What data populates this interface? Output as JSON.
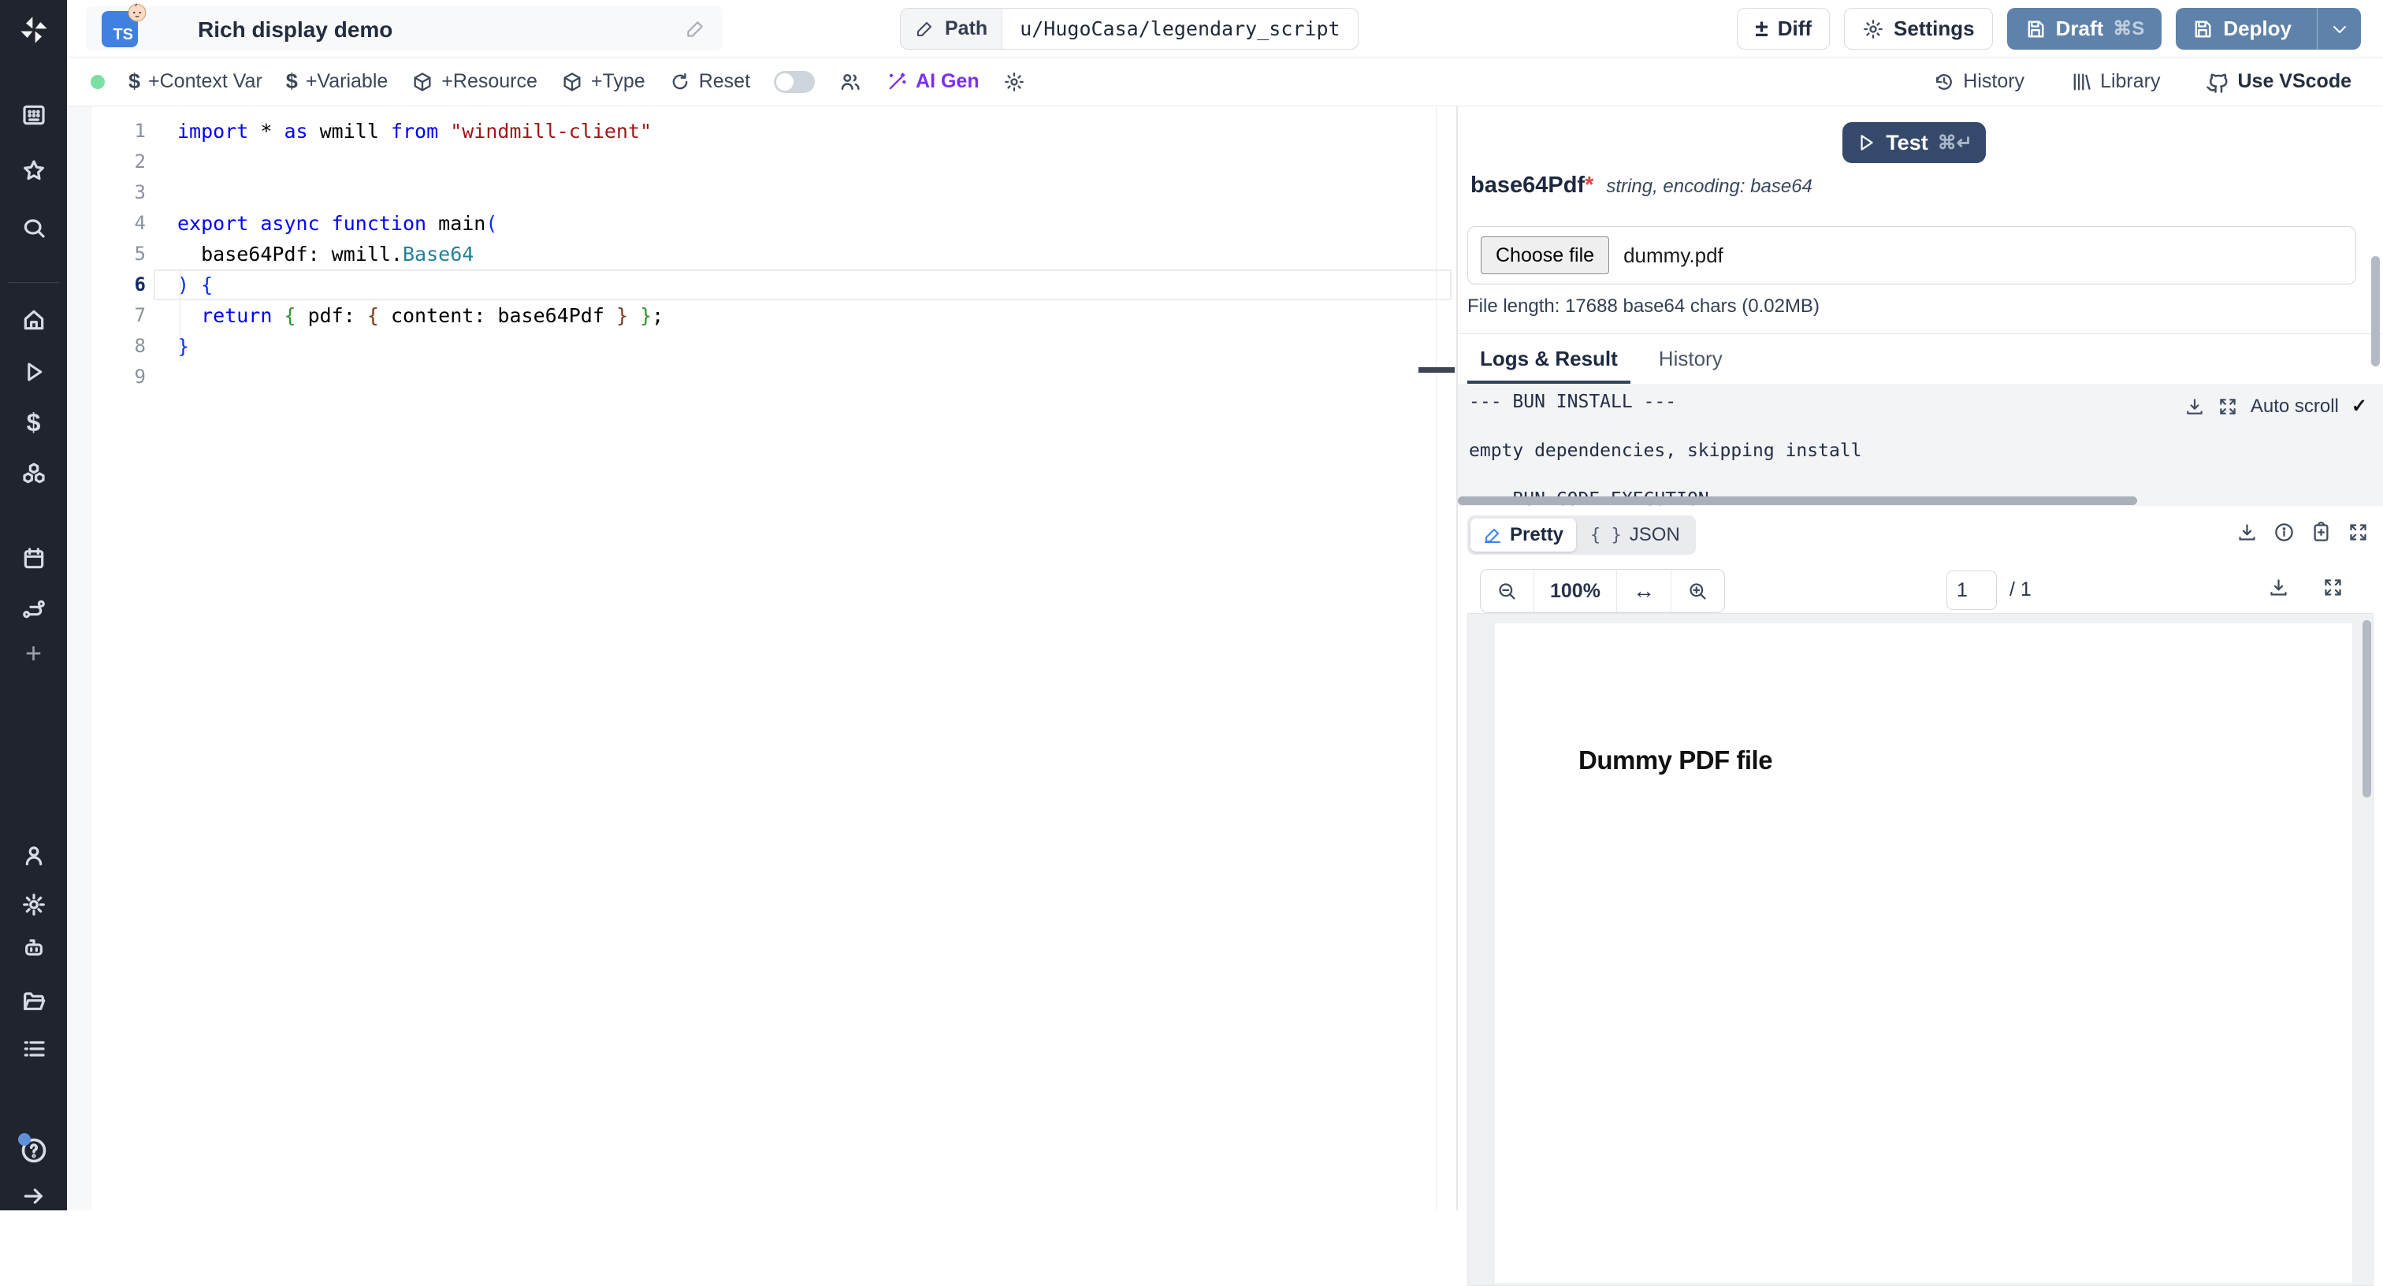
{
  "topbar": {
    "title": "Rich display demo",
    "ts_badge": "TS",
    "path_label": "Path",
    "path_value": "u/HugoCasa/legendary_script",
    "diff_label": "Diff",
    "diff_glyph": "±",
    "settings_label": "Settings",
    "draft_label": "Draft",
    "draft_shortcut": "⌘S",
    "deploy_label": "Deploy"
  },
  "toolbar": {
    "context_var": "+Context Var",
    "variable": "+Variable",
    "resource": "+Resource",
    "type": "+Type",
    "reset": "Reset",
    "ai_gen": "AI Gen",
    "dollar_glyph": "$",
    "history": "History",
    "library": "Library",
    "vscode": "Use VScode"
  },
  "sidebar": {
    "icon_names_top": [
      "windmill-logo",
      "apps-grid-icon",
      "star-icon",
      "search-icon",
      "home-icon",
      "runs-play-icon",
      "variables-dollar-icon",
      "resources-cubes-icon",
      "schedules-calendar-icon",
      "flows-route-icon",
      "plus-icon"
    ],
    "icon_names_bottom": [
      "user-icon",
      "settings-gear-icon",
      "workers-bot-icon",
      "folders-icon",
      "logs-list-icon",
      "help-icon",
      "expand-arrow-icon"
    ],
    "dollar_glyph": "$",
    "plus_glyph": "+"
  },
  "editor": {
    "active_line": 6,
    "lines": [
      {
        "n": "1",
        "tokens": [
          [
            "import ",
            "kw"
          ],
          [
            "* ",
            "pl"
          ],
          [
            "as ",
            "kw"
          ],
          [
            "wmill ",
            "pl"
          ],
          [
            "from ",
            "kw"
          ],
          [
            "\"windmill-client\"",
            "str"
          ]
        ]
      },
      {
        "n": "2",
        "tokens": []
      },
      {
        "n": "3",
        "tokens": []
      },
      {
        "n": "4",
        "tokens": [
          [
            "export ",
            "kw"
          ],
          [
            "async ",
            "kw"
          ],
          [
            "function ",
            "kw"
          ],
          [
            "main",
            "pl"
          ],
          [
            "(",
            "b1"
          ]
        ]
      },
      {
        "n": "5",
        "tokens": [
          [
            "  base64Pdf: wmill.",
            "pl"
          ],
          [
            "Base64",
            "type"
          ]
        ]
      },
      {
        "n": "6",
        "tokens": [
          [
            ") {",
            "b1"
          ]
        ]
      },
      {
        "n": "7",
        "tokens": [
          [
            "  return ",
            "kw"
          ],
          [
            "{ ",
            "b2"
          ],
          [
            "pdf: ",
            "pl"
          ],
          [
            "{ ",
            "b3"
          ],
          [
            "content: base64Pdf ",
            "pl"
          ],
          [
            "} ",
            "b3"
          ],
          [
            "}",
            "b2"
          ],
          [
            ";",
            "pl"
          ]
        ]
      },
      {
        "n": "8",
        "tokens": [
          [
            "}",
            "b1"
          ]
        ]
      },
      {
        "n": "9",
        "tokens": []
      }
    ]
  },
  "panel": {
    "test_label": "Test",
    "test_shortcut": "⌘↵",
    "arg_name": "base64Pdf",
    "arg_required": "*",
    "arg_type": "string, encoding: base64",
    "choose_file_label": "Choose file",
    "file_name": "dummy.pdf",
    "file_length": "File length: 17688 base64 chars (0.02MB)",
    "tabs": [
      "Logs & Result",
      "History"
    ],
    "auto_scroll_label": "Auto scroll",
    "check_glyph": "✓",
    "log_lines": [
      "--- BUN INSTALL ---",
      "empty dependencies, skipping install",
      "--- BUN CODE EXECUTION ---"
    ],
    "pretty_label": "Pretty",
    "json_label": "JSON",
    "json_brace_glyph": "{ }",
    "zoom_value": "100%",
    "fit_width_glyph": "↔",
    "page_value": "1",
    "page_total": "/ 1",
    "pdf_text": "Dummy PDF file"
  },
  "colors": {
    "sidebar_bg": "#20242d",
    "primary_button": "#5e82aa",
    "test_button": "#35496a",
    "ai_accent": "#7b2ff2",
    "status_green": "#7ce0a5",
    "ts_badge_blue": "#4080e0",
    "active_tab_underline": "#31425c",
    "log_bg": "#f3f4f6",
    "keyword_blue": "#0000ff",
    "string_red": "#a31515",
    "type_teal": "#267f99"
  }
}
